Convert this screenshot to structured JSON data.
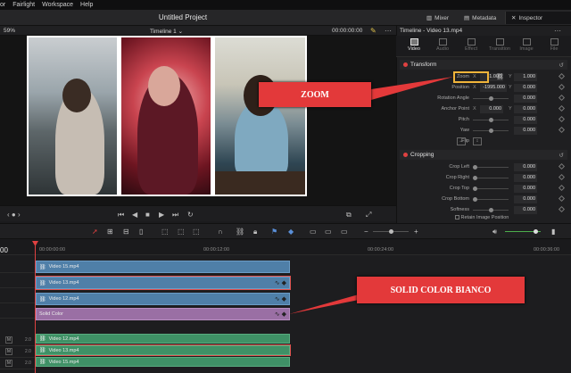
{
  "menu": [
    "or",
    "Fairlight",
    "Workspace",
    "Help"
  ],
  "project_title": "Untitled Project",
  "top_tabs": {
    "mixer": "Mixer",
    "metadata": "Metadata",
    "inspector": "Inspector"
  },
  "viewer": {
    "timeline_name": "Timeline 1",
    "timecode": "00:00:00:00",
    "zoom_label": "59%"
  },
  "inspector": {
    "title": "Timeline - Video 13.mp4",
    "tabs": [
      "Video",
      "Audio",
      "Effect",
      "Transition",
      "Image",
      "File"
    ],
    "transform": {
      "heading": "Transform",
      "zoom": {
        "label": "Zoom",
        "x": "1.000",
        "y": "1.000"
      },
      "position": {
        "label": "Position",
        "x": "-1995.000",
        "y": "0.000"
      },
      "rotation": {
        "label": "Rotation Angle",
        "value": "0.000"
      },
      "anchor": {
        "label": "Anchor Point",
        "x": "0.000",
        "y": "0.000"
      },
      "pitch": {
        "label": "Pitch",
        "value": "0.000"
      },
      "yaw": {
        "label": "Yaw",
        "value": "0.000"
      },
      "flip": {
        "label": "Flip"
      }
    },
    "cropping": {
      "heading": "Cropping",
      "left": {
        "label": "Crop Left",
        "value": "0.000"
      },
      "right": {
        "label": "Crop Right",
        "value": "0.000"
      },
      "top": {
        "label": "Crop Top",
        "value": "0.000"
      },
      "bottom": {
        "label": "Crop Bottom",
        "value": "0.000"
      },
      "softness": {
        "label": "Softness",
        "value": "0.000"
      },
      "retain": "Retain Image Position"
    }
  },
  "timeline": {
    "ruler": [
      "00:00:00:00",
      "00:00:12:00",
      "00:00:24:00",
      "00:00:36:00"
    ],
    "ruler_zero": "00",
    "clips": {
      "v_top": "Video 15.mp4",
      "v_mid": "Video 13.mp4",
      "v_low": "Video 12.mp4",
      "solid": "Solid Color",
      "a1": "Video 12.mp4",
      "a2": "Video 13.mp4",
      "a3": "Video 15.mp4"
    },
    "track_labels": {
      "m": "M",
      "a_level": "2.0"
    }
  },
  "annotations": {
    "zoom": "ZOOM",
    "solid": "SOLID COLOR BIANCO"
  },
  "colors": {
    "accent_red": "#e3393a",
    "zoom_box": "#f0b43a",
    "clip_blue": "#4f7fa8",
    "clip_purple": "#9a6fa4",
    "clip_green": "#3f9166"
  }
}
